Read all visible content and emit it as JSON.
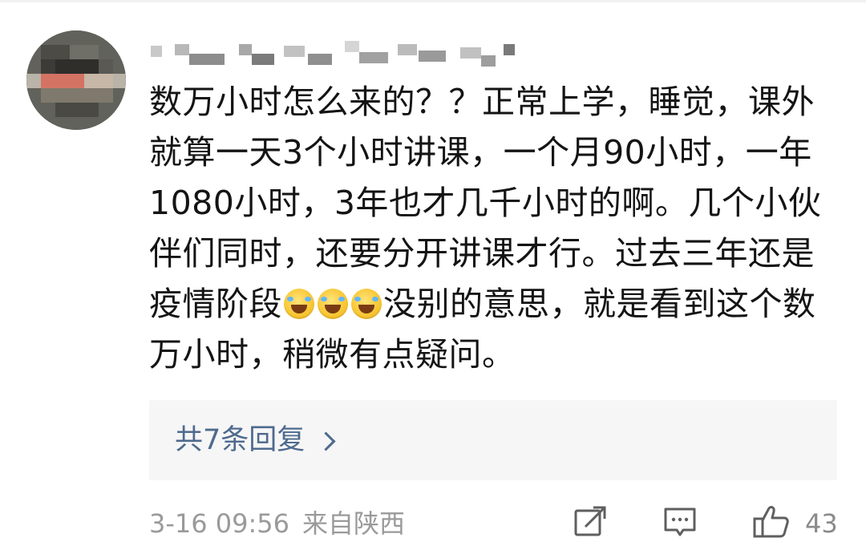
{
  "comment": {
    "username": "",
    "text_before_emoji": "数万小时怎么来的？？正常上学，睡觉，课外就算一天3个小时讲课，一个月90小时，一年1080小时，3年也才几千小时的啊。几个小伙伴们同时，还要分开讲课才行。过去三年还是疫情阶段",
    "emoji": [
      "laughing-crying-emoji",
      "laughing-crying-emoji",
      "laughing-crying-emoji"
    ],
    "text_after_emoji": "没别的意思，就是看到这个数万小时，稍微有点疑问。"
  },
  "replies": {
    "label": "共7条回复"
  },
  "footer": {
    "timestamp": "3-16 09:56",
    "source": "来自陕西",
    "like_count": "43"
  },
  "icons": {
    "share": "share-icon",
    "comment": "comment-icon",
    "like": "thumbs-up-icon",
    "chevron": "chevron-right-icon"
  },
  "colors": {
    "reply_link": "#4e6a8e",
    "meta_text": "#9a9a9a",
    "reply_box_bg": "#f6f6f6",
    "body_text": "#141414"
  }
}
